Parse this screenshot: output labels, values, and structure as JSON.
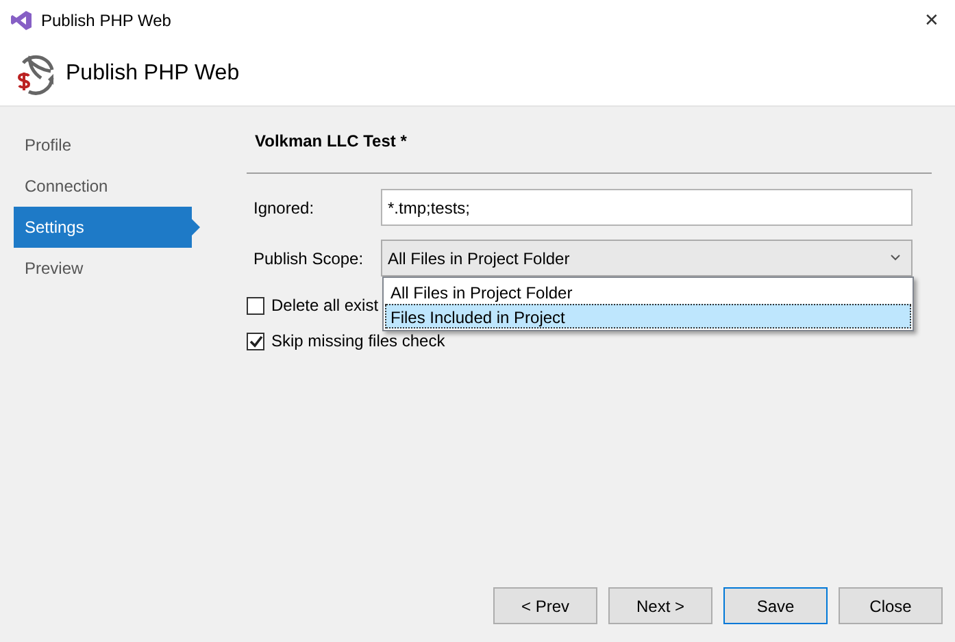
{
  "window": {
    "title": "Publish PHP Web",
    "close": "✕"
  },
  "header": {
    "title": "Publish PHP Web"
  },
  "sidebar": {
    "items": [
      {
        "label": "Profile",
        "selected": false
      },
      {
        "label": "Connection",
        "selected": false
      },
      {
        "label": "Settings",
        "selected": true
      },
      {
        "label": "Preview",
        "selected": false
      }
    ]
  },
  "settings": {
    "profile_title": "Volkman LLC Test *",
    "ignored": {
      "label": "Ignored:",
      "value": "*.tmp;tests;"
    },
    "scope": {
      "label": "Publish Scope:",
      "value": "All Files in Project Folder",
      "expanded": true,
      "options": [
        {
          "label": "All Files in Project Folder",
          "highlighted": false
        },
        {
          "label": "Files Included in Project",
          "highlighted": true
        }
      ]
    },
    "checkboxes": [
      {
        "label": "Delete all exist",
        "checked": false
      },
      {
        "label": "Skip missing files check",
        "checked": true
      }
    ]
  },
  "buttons": [
    {
      "label": "< Prev",
      "default": false
    },
    {
      "label": "Next >",
      "default": false
    },
    {
      "label": "Save",
      "default": true
    },
    {
      "label": "Close",
      "default": false
    }
  ]
}
